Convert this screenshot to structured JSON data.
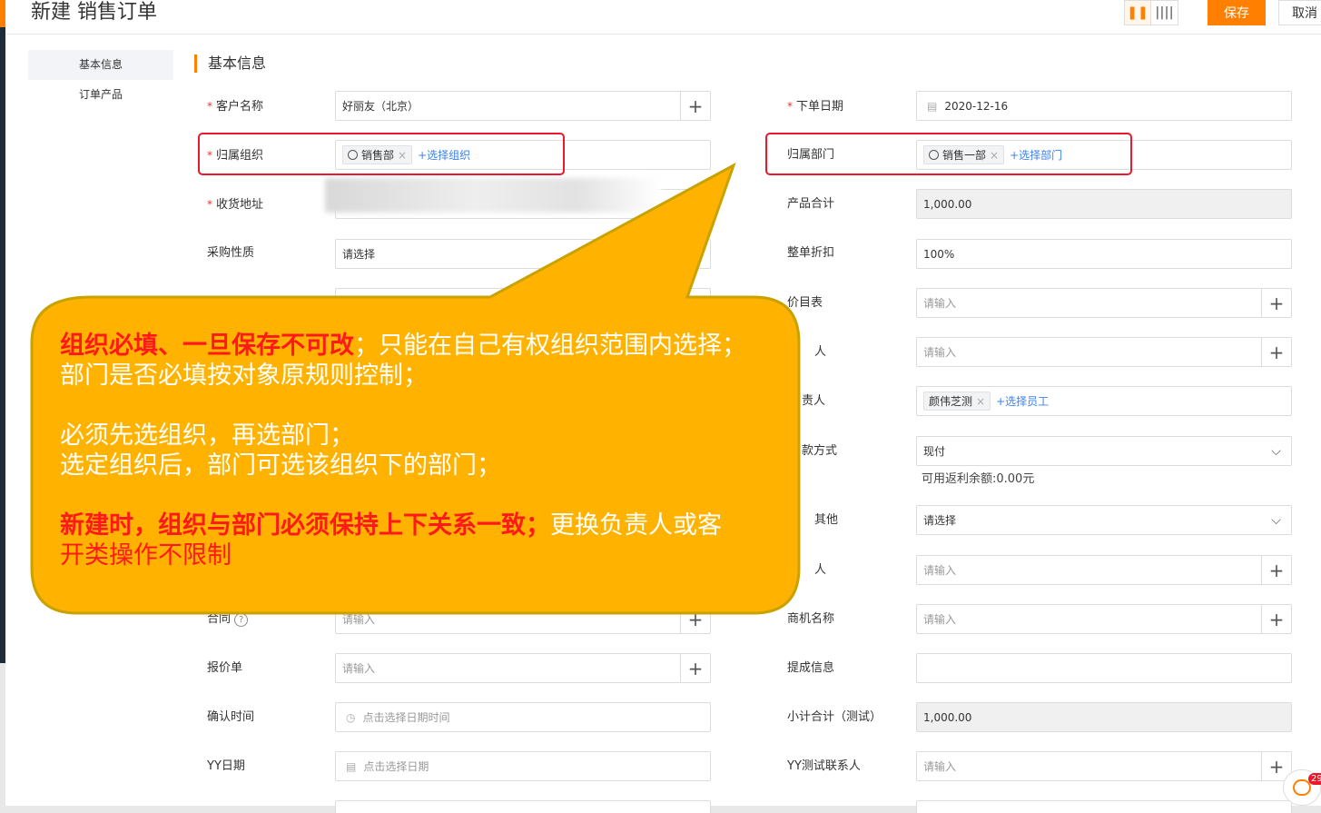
{
  "header": {
    "title": "新建 销售订单",
    "save_label": "保存",
    "cancel_label": "取消"
  },
  "nav": {
    "items": [
      "基本信息",
      "订单产品"
    ]
  },
  "section": {
    "title": "基本信息"
  },
  "fields": {
    "customer": {
      "label": "客户名称",
      "value": "好丽友（北京）"
    },
    "org": {
      "label": "归属组织",
      "tag": "销售部",
      "add": "+选择组织"
    },
    "address": {
      "label": "收货地址"
    },
    "purchase": {
      "label": "采购性质",
      "value": "请选择"
    },
    "contract": {
      "label": "合同",
      "help": "?",
      "placeholder": "请输入"
    },
    "quote": {
      "label": "报价单",
      "placeholder": "请输入"
    },
    "confirm_time": {
      "label": "确认时间",
      "placeholder": "点击选择日期时间"
    },
    "yy_date": {
      "label": "YY日期",
      "placeholder": "点击选择日期"
    },
    "order_date": {
      "label": "下单日期",
      "value": "2020-12-16"
    },
    "dept": {
      "label": "归属部门",
      "tag": "销售一部",
      "add": "+选择部门"
    },
    "product_total": {
      "label": "产品合计",
      "value": "1,000.00"
    },
    "discount": {
      "label": "整单折扣",
      "value": "100%"
    },
    "pricelist": {
      "label": "价目表",
      "placeholder": "请输入"
    },
    "row6": {
      "label": "人",
      "placeholder": "请输入"
    },
    "owner": {
      "label": "责人",
      "tag": "颜伟芝测",
      "add": "+选择员工"
    },
    "payment": {
      "label": "款方式",
      "value": "现付",
      "note": "可用返利余额:0.00元"
    },
    "other": {
      "label": "其他",
      "value": "请选择"
    },
    "row10": {
      "label": "人",
      "placeholder": "请输入"
    },
    "opportunity": {
      "label": "商机名称",
      "placeholder": "请输入"
    },
    "commission": {
      "label": "提成信息"
    },
    "subtotal": {
      "label": "小计合计（测试）",
      "value": "1,000.00"
    },
    "yy_contact": {
      "label": "YY测试联系人",
      "placeholder": "请输入"
    }
  },
  "callout": {
    "p1_bold": "组织必填、一旦保存不可改",
    "p1_rest": "；只能在自己有权组织范围内选择；",
    "p2": "部门是否必填按对象原规则控制；",
    "p3": "必须先选组织，再选部门；",
    "p4": "选定组织后，部门可选该组织下的部门；",
    "p5_bold": "新建时，组织与部门必须保持上下关系一致；",
    "p5_rest": "更换负责人或客",
    "p6": "开类操作不限制"
  },
  "chat": {
    "count": "29"
  },
  "colors": {
    "accent": "#ff8000",
    "callout": "#ffb300",
    "highlight": "#e8192c"
  }
}
